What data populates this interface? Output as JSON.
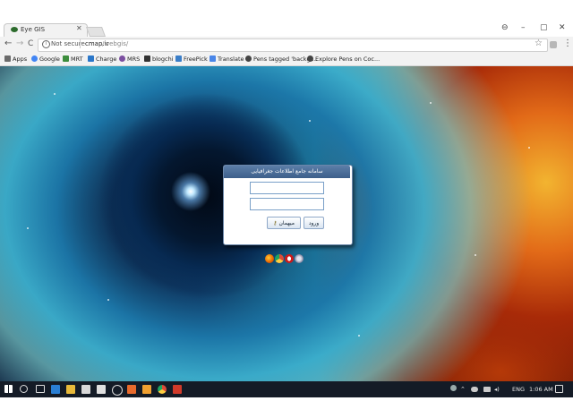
{
  "tab": {
    "title": "Eye GIS"
  },
  "window_controls": {
    "profile": "⊖",
    "minimize": "–",
    "maximize": "▢",
    "close": "✕"
  },
  "toolbar": {
    "back": "←",
    "forward": "→",
    "reload": "C",
    "security_label": "Not secure",
    "url_host": "cmap.ir",
    "url_path": "/webgis/",
    "star": "☆",
    "menu": "⋮"
  },
  "bookmarks": [
    {
      "label": "Apps",
      "color": "#6b6b6b"
    },
    {
      "label": "Google",
      "color": "#4285f4"
    },
    {
      "label": "MRT",
      "color": "#3c8d3c"
    },
    {
      "label": "Charge",
      "color": "#2b77c9"
    },
    {
      "label": "MRS",
      "color": "#7b4fa0"
    },
    {
      "label": "blogchi",
      "color": "#333333"
    },
    {
      "label": "FreePick",
      "color": "#3b7ec8"
    },
    {
      "label": "Translate",
      "color": "#4a86e8"
    },
    {
      "label": "Pens tagged 'backgr...",
      "color": "#444444"
    },
    {
      "label": "Explore Pens on Coc...",
      "color": "#444444"
    }
  ],
  "login": {
    "title": "سامانه جامع اطلاعات جغرافیایی",
    "username_value": "",
    "password_value": "",
    "guest_button": "میهمان",
    "login_button": "ورود"
  },
  "browser_icons": [
    {
      "name": "firefox-icon",
      "color": "#e66000"
    },
    {
      "name": "chrome-icon",
      "color": "#dd4b39"
    },
    {
      "name": "opera-icon",
      "color": "#cc1a1a"
    },
    {
      "name": "safari-icon",
      "color": "#7d7d9a"
    }
  ],
  "taskbar": {
    "language": "ENG",
    "time": "1:06 AM"
  },
  "colors": {
    "dialog_header": "#4a6d98",
    "taskbar": "#141b26"
  }
}
